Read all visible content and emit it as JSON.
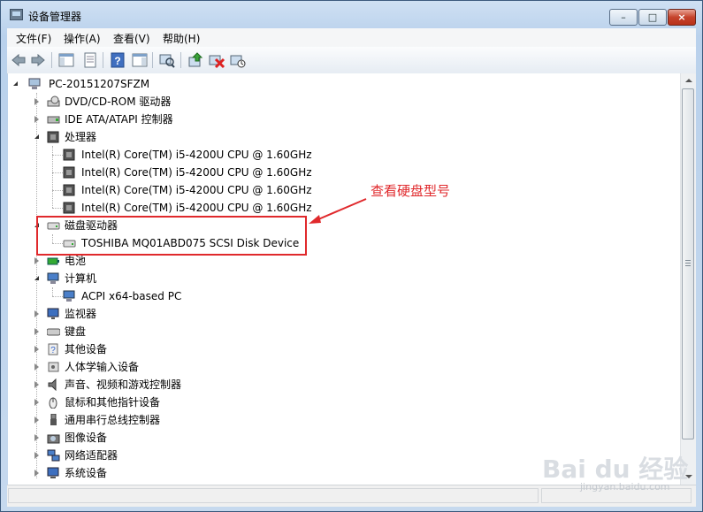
{
  "window": {
    "title": "设备管理器",
    "buttons": {
      "minimize": "–",
      "maximize": "□",
      "close": "×"
    }
  },
  "menu": [
    {
      "label": "文件(F)"
    },
    {
      "label": "操作(A)"
    },
    {
      "label": "查看(V)"
    },
    {
      "label": "帮助(H)"
    }
  ],
  "toolbar": {
    "icons": [
      "back-arrow-icon",
      "forward-arrow-icon",
      "show-hide-tree-icon",
      "properties-icon",
      "help-icon",
      "action-pane-icon",
      "scan-hardware-icon",
      "update-driver-icon",
      "disable-device-icon",
      "uninstall-device-icon"
    ]
  },
  "tree": {
    "root": "PC-20151207SFZM",
    "dvd": "DVD/CD-ROM 驱动器",
    "ide": "IDE ATA/ATAPI 控制器",
    "processors": "处理器",
    "cpu1": "Intel(R) Core(TM) i5-4200U CPU @ 1.60GHz",
    "cpu2": "Intel(R) Core(TM) i5-4200U CPU @ 1.60GHz",
    "cpu3": "Intel(R) Core(TM) i5-4200U CPU @ 1.60GHz",
    "cpu4": "Intel(R) Core(TM) i5-4200U CPU @ 1.60GHz",
    "disk_drives": "磁盘驱动器",
    "disk": "TOSHIBA MQ01ABD075 SCSI Disk Device",
    "battery": "电池",
    "computer": "计算机",
    "acpi": "ACPI x64-based PC",
    "monitors": "监视器",
    "keyboards": "键盘",
    "other": "其他设备",
    "hid": "人体学输入设备",
    "sound": "声音、视频和游戏控制器",
    "mice": "鼠标和其他指针设备",
    "usb": "通用串行总线控制器",
    "imaging": "图像设备",
    "network": "网络适配器",
    "system": "系统设备"
  },
  "annotation": {
    "text": "查看硬盘型号",
    "color": "#e0292c"
  },
  "watermark": {
    "logo": "Bai du 经验",
    "url": "jingyan.baidu.com"
  },
  "colors": {
    "annotation": "#e0292c",
    "title_bar": "#cfe0f3",
    "close_button": "#c5432c"
  }
}
